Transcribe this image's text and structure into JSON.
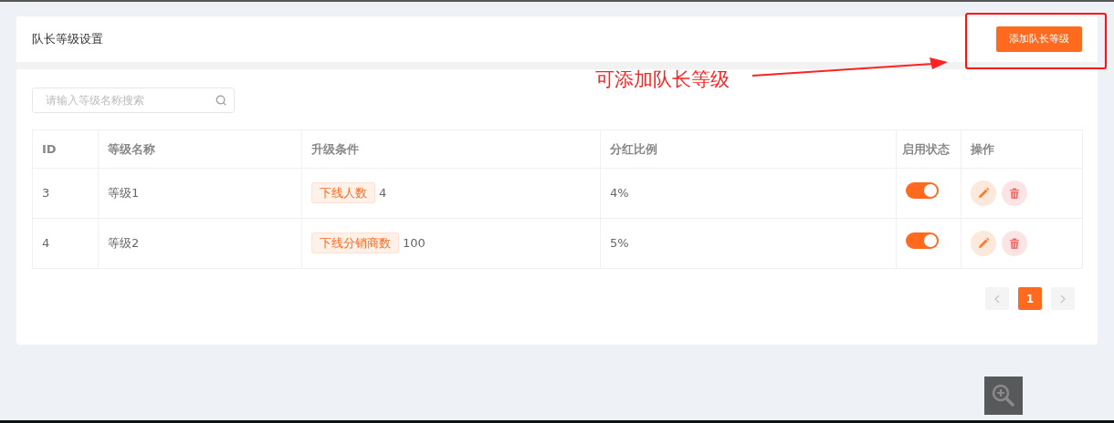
{
  "header": {
    "title": "队长等级设置",
    "add_button": "添加队长等级"
  },
  "annotation": {
    "text": "可添加队长等级"
  },
  "search": {
    "placeholder": "请输入等级名称搜索"
  },
  "table": {
    "columns": [
      "ID",
      "等级名称",
      "升级条件",
      "分红比例",
      "启用状态",
      "操作"
    ],
    "rows": [
      {
        "id": "3",
        "name": "等级1",
        "condition_tag": "下线人数",
        "condition_value": "4",
        "ratio": "4%",
        "enabled": true
      },
      {
        "id": "4",
        "name": "等级2",
        "condition_tag": "下线分销商数",
        "condition_value": "100",
        "ratio": "5%",
        "enabled": true
      }
    ]
  },
  "pagination": {
    "pages": [
      {
        "label": "1",
        "selected": true
      }
    ]
  }
}
